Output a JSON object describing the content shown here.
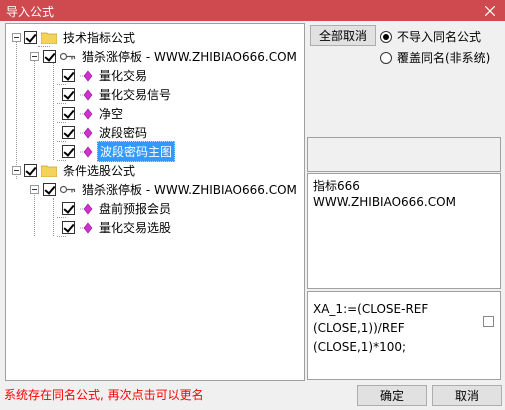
{
  "window": {
    "title": "导入公式",
    "close": "close"
  },
  "colors": {
    "titlebar": "#ce4a4f",
    "selection": "#3399ff",
    "status": "#ff0000"
  },
  "tree": {
    "root1": "技术指标公式",
    "root1_child": "猎杀涨停板 - WWW.ZHIBIAO666.COM",
    "root1_items": [
      "量化交易",
      "量化交易信号",
      "净空",
      "波段密码",
      "波段密码主图"
    ],
    "root2": "条件选股公式",
    "root2_child": "猎杀涨停板 - WWW.ZHIBIAO666.COM",
    "root2_items": [
      "盘前预报会员",
      "量化交易选股"
    ]
  },
  "actions": {
    "deselect_all": "全部取消",
    "radio_no_import": "不导入同名公式",
    "radio_overwrite": "覆盖同名(非系统)",
    "ok": "确定",
    "cancel": "取消"
  },
  "info": {
    "text": "指标666\nWWW.ZHIBIAO666.COM"
  },
  "formula": {
    "text": "XA_1:=(CLOSE-REF\n(CLOSE,1))/REF\n(CLOSE,1)*100;"
  },
  "status": "系统存在同名公式, 再次点击可以更名"
}
